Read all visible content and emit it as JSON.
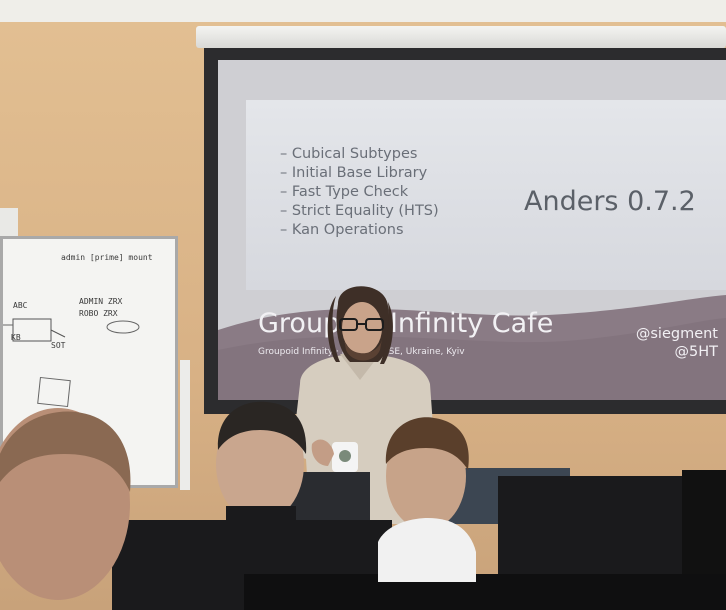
{
  "slide": {
    "bullets": [
      "– Cubical Subtypes",
      "– Initial Base Library",
      "– Fast Type Check",
      "– Strict Equality (HTS)",
      "– Kan Operations"
    ],
    "version": "Anders 0.7.2",
    "title": "Groupoid Infinity Cafe",
    "subtitle": "Groupoid Infinity · KYIVTECH SE, Ukraine, Kyiv",
    "handles": [
      "@siegment",
      "@5HT"
    ]
  },
  "whiteboard": {
    "notes": [
      "admin [prime] mount",
      "ABC",
      "ADMIN  ZRX",
      "ROBO  ZRX",
      "KB",
      "SOT"
    ]
  },
  "colors": {
    "wall": "#e2bf92",
    "slide_background": "#e4e6ea",
    "slide_band": "#8a7b85",
    "screen_frame": "#2c2c2e",
    "shirt": "#d6cdbf"
  }
}
